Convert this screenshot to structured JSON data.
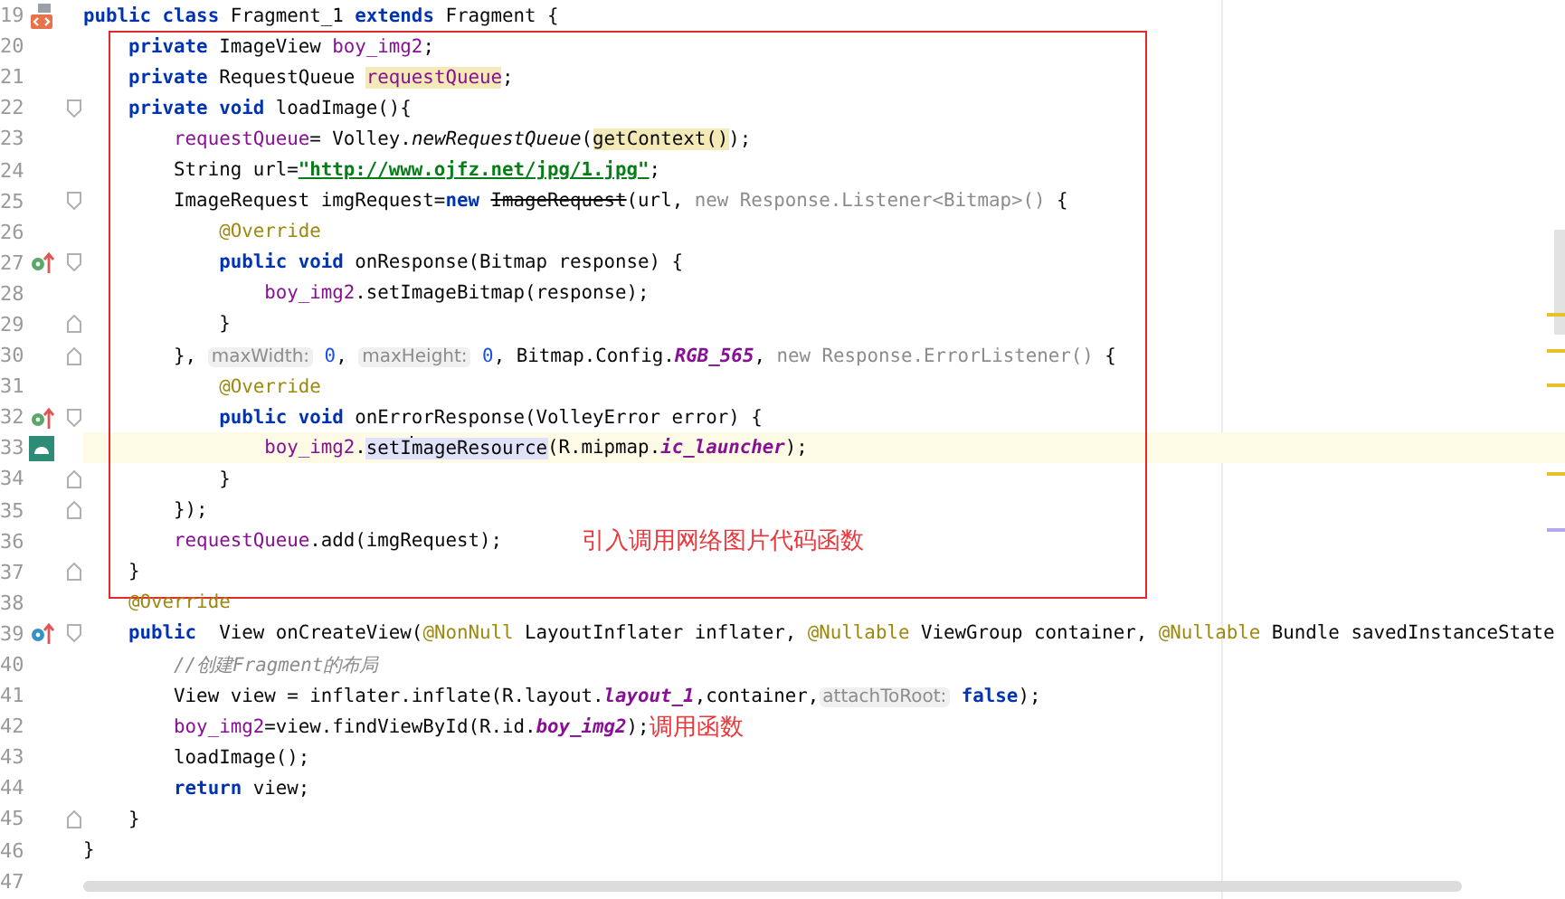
{
  "editor": {
    "blocks": [
      {
        "kind": "plain",
        "lines": [
          {
            "number": "19",
            "marker": {
              "kind": "class"
            },
            "current": false,
            "segments": [
              {
                "text": "public class ",
                "kind": "kw"
              },
              {
                "text": "Fragment_1 ",
                "kind": "plain"
              },
              {
                "text": "extends ",
                "kind": "kw"
              },
              {
                "text": "Fragment {",
                "kind": "plain"
              }
            ]
          }
        ]
      },
      {
        "kind": "boxed",
        "lines": [
          {
            "number": "20",
            "current": false,
            "segments": [
              {
                "text": "    private ",
                "kind": "kw"
              },
              {
                "text": "ImageView ",
                "kind": "plain"
              },
              {
                "text": "boy_img2",
                "kind": "field"
              },
              {
                "text": ";",
                "kind": "plain"
              }
            ]
          },
          {
            "number": "21",
            "current": false,
            "segments": [
              {
                "text": "    private ",
                "kind": "kw"
              },
              {
                "text": "RequestQueue ",
                "kind": "plain"
              },
              {
                "text": "requestQueue",
                "kind": "field",
                "usage_highlight": true
              },
              {
                "text": ";",
                "kind": "plain"
              }
            ]
          },
          {
            "number": "22",
            "fold": {
              "kind": "start"
            },
            "current": false,
            "segments": [
              {
                "text": "    private void ",
                "kind": "kw"
              },
              {
                "text": "loadImage(){",
                "kind": "plain"
              }
            ]
          },
          {
            "number": "23",
            "current": false,
            "segments": [
              {
                "text": "        requestQueue",
                "kind": "field"
              },
              {
                "text": "= Volley.",
                "kind": "plain"
              },
              {
                "text": "newRequestQueue",
                "kind": "static"
              },
              {
                "text": "(",
                "kind": "plain"
              },
              {
                "text": "getContext()",
                "kind": "plain",
                "usage_highlight": true
              },
              {
                "text": ");",
                "kind": "plain"
              }
            ]
          },
          {
            "number": "24",
            "current": false,
            "segments": [
              {
                "text": "        String url=",
                "kind": "plain"
              },
              {
                "text": "\"http://www.ojfz.net/jpg/1.jpg\"",
                "kind": "string"
              },
              {
                "text": ";",
                "kind": "plain"
              }
            ]
          },
          {
            "number": "25",
            "fold": {
              "kind": "start"
            },
            "current": false,
            "segments": [
              {
                "text": "        ImageRequest imgRequest=",
                "kind": "plain"
              },
              {
                "text": "new ",
                "kind": "kw"
              },
              {
                "text": "ImageRequest",
                "kind": "deprecated"
              },
              {
                "text": "(url, ",
                "kind": "plain"
              },
              {
                "text": "new Response.Listener<Bitmap>() ",
                "kind": "dim"
              },
              {
                "text": "{",
                "kind": "plain"
              }
            ]
          },
          {
            "number": "26",
            "current": false,
            "segments": [
              {
                "text": "            @Override",
                "kind": "ann"
              }
            ]
          },
          {
            "number": "27",
            "marker": {
              "kind": "override"
            },
            "fold": {
              "kind": "start"
            },
            "current": false,
            "segments": [
              {
                "text": "            public void ",
                "kind": "kw"
              },
              {
                "text": "onResponse(Bitmap response) {",
                "kind": "plain"
              }
            ]
          },
          {
            "number": "28",
            "current": false,
            "segments": [
              {
                "text": "                boy_img2",
                "kind": "field"
              },
              {
                "text": ".setImageBitmap(response);",
                "kind": "plain"
              }
            ]
          },
          {
            "number": "29",
            "fold": {
              "kind": "end"
            },
            "current": false,
            "segments": [
              {
                "text": "            }",
                "kind": "plain"
              }
            ]
          },
          {
            "number": "30",
            "fold": {
              "kind": "end"
            },
            "current": false,
            "segments": [
              {
                "text": "        }, ",
                "kind": "plain"
              },
              {
                "text": "maxWidth:",
                "kind": "hint"
              },
              {
                "text": " 0",
                "kind": "num"
              },
              {
                "text": ", ",
                "kind": "plain"
              },
              {
                "text": "maxHeight:",
                "kind": "hint"
              },
              {
                "text": " 0",
                "kind": "num"
              },
              {
                "text": ", Bitmap.Config.",
                "kind": "plain"
              },
              {
                "text": "RGB_565",
                "kind": "ifield"
              },
              {
                "text": ", ",
                "kind": "plain"
              },
              {
                "text": "new Response.ErrorListener() ",
                "kind": "dim"
              },
              {
                "text": "{",
                "kind": "plain"
              }
            ]
          },
          {
            "number": "31",
            "current": false,
            "segments": [
              {
                "text": "            @Override",
                "kind": "ann"
              }
            ]
          },
          {
            "number": "32",
            "marker": {
              "kind": "override"
            },
            "fold": {
              "kind": "start"
            },
            "current": false,
            "segments": [
              {
                "text": "            public void ",
                "kind": "kw"
              },
              {
                "text": "onErrorResponse(VolleyError error) {",
                "kind": "plain"
              }
            ]
          },
          {
            "number": "33",
            "marker": {
              "kind": "android"
            },
            "current": true,
            "segments": [
              {
                "text": "                boy_img2",
                "kind": "field"
              },
              {
                "text": ".",
                "kind": "plain"
              },
              {
                "text": "setI",
                "kind": "plain",
                "reference_highlight": true
              },
              {
                "text": "mageResource",
                "kind": "plain",
                "reference_highlight": true,
                "caret": true
              },
              {
                "text": "(R.mipmap.",
                "kind": "plain"
              },
              {
                "text": "ic_launcher",
                "kind": "ifield"
              },
              {
                "text": ");",
                "kind": "plain"
              }
            ]
          },
          {
            "number": "34",
            "fold": {
              "kind": "end"
            },
            "current": false,
            "segments": [
              {
                "text": "            }",
                "kind": "plain"
              }
            ]
          },
          {
            "number": "35",
            "fold": {
              "kind": "end"
            },
            "current": false,
            "segments": [
              {
                "text": "        });",
                "kind": "plain"
              }
            ]
          },
          {
            "number": "36",
            "current": false,
            "segments": [
              {
                "text": "        requestQueue",
                "kind": "field"
              },
              {
                "text": ".add(imgRequest);",
                "kind": "plain"
              }
            ],
            "note": {
              "text": "引入调用网络图片代码函数",
              "kind": "apart"
            }
          },
          {
            "number": "37",
            "fold": {
              "kind": "end"
            },
            "current": false,
            "segments": [
              {
                "text": "    }",
                "kind": "plain"
              }
            ]
          }
        ]
      },
      {
        "kind": "plain",
        "lines": [
          {
            "number": "38",
            "current": false,
            "segments": [
              {
                "text": "    @Override",
                "kind": "ann"
              }
            ]
          },
          {
            "number": "39",
            "marker": {
              "kind": "implements"
            },
            "fold": {
              "kind": "start"
            },
            "current": false,
            "segments": [
              {
                "text": "    public  ",
                "kind": "kw"
              },
              {
                "text": "View onCreateView(",
                "kind": "plain"
              },
              {
                "text": "@NonNull ",
                "kind": "ann"
              },
              {
                "text": "LayoutInflater inflater, ",
                "kind": "plain"
              },
              {
                "text": "@Nullable ",
                "kind": "ann"
              },
              {
                "text": "ViewGroup container, ",
                "kind": "plain"
              },
              {
                "text": "@Nullable ",
                "kind": "ann"
              },
              {
                "text": "Bundle savedInstanceState",
                "kind": "plain"
              }
            ]
          },
          {
            "number": "40",
            "current": false,
            "segments": [
              {
                "text": "        //创建Fragment的布局",
                "kind": "comment"
              }
            ]
          },
          {
            "number": "41",
            "current": false,
            "segments": [
              {
                "text": "        View view = inflater.inflate(R.layout.",
                "kind": "plain"
              },
              {
                "text": "layout_1",
                "kind": "ifield"
              },
              {
                "text": ",container,",
                "kind": "plain"
              },
              {
                "text": "attachToRoot:",
                "kind": "hint"
              },
              {
                "text": " false",
                "kind": "kw"
              },
              {
                "text": ");",
                "kind": "plain"
              }
            ]
          },
          {
            "number": "42",
            "current": false,
            "segments": [
              {
                "text": "        boy_img2",
                "kind": "field"
              },
              {
                "text": "=view.findViewById(R.id.",
                "kind": "plain"
              },
              {
                "text": "boy_img2",
                "kind": "ifield"
              },
              {
                "text": ");",
                "kind": "plain"
              }
            ],
            "note": {
              "text": "调用函数",
              "kind": "adjacent"
            }
          },
          {
            "number": "43",
            "current": false,
            "segments": [
              {
                "text": "        loadImage();",
                "kind": "plain"
              }
            ]
          },
          {
            "number": "44",
            "current": false,
            "segments": [
              {
                "text": "        return ",
                "kind": "kw"
              },
              {
                "text": "view;",
                "kind": "plain"
              }
            ]
          },
          {
            "number": "45",
            "fold": {
              "kind": "end"
            },
            "current": false,
            "segments": [
              {
                "text": "    }",
                "kind": "plain"
              }
            ]
          },
          {
            "number": "46",
            "current": false,
            "segments": [
              {
                "text": "}",
                "kind": "plain"
              }
            ]
          },
          {
            "number": "47",
            "current": false
          }
        ]
      }
    ]
  }
}
